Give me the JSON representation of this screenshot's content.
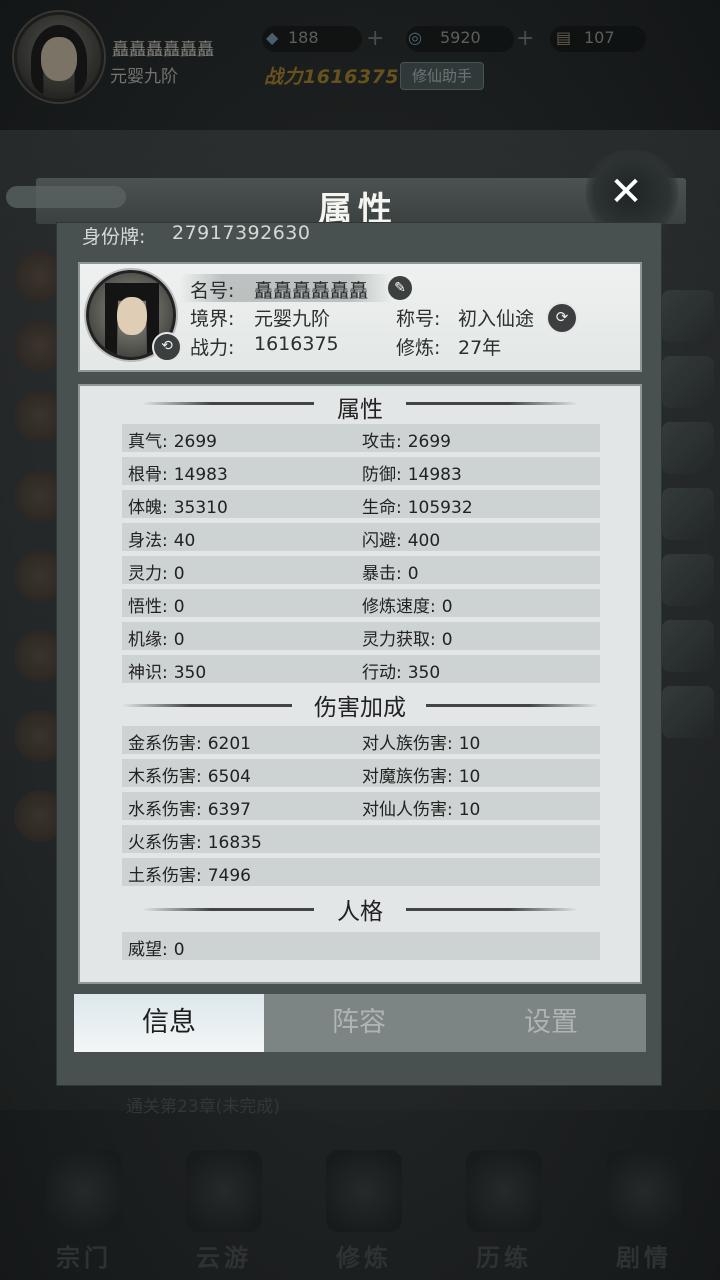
{
  "header": {
    "player_name": "矗矗矗矗矗矗",
    "realm": "元婴九阶",
    "resources": [
      {
        "icon": "crystal-icon",
        "value": "188"
      },
      {
        "icon": "spirit-orb-icon",
        "value": "5920"
      },
      {
        "icon": "scroll-icon",
        "value": "107"
      }
    ],
    "power_label": "战力",
    "power_value": "1616375",
    "helper_button": "修仙助手"
  },
  "background": {
    "chapter_title": "第二十三章",
    "chapter_progress": "通关第23章(未完成)"
  },
  "bottom_nav": [
    {
      "label": "宗门",
      "icon": "sect-icon"
    },
    {
      "label": "云游",
      "icon": "travel-icon"
    },
    {
      "label": "修炼",
      "icon": "cultivate-icon"
    },
    {
      "label": "历练",
      "icon": "trial-icon"
    },
    {
      "label": "剧情",
      "icon": "story-icon"
    }
  ],
  "modal": {
    "title": "属性",
    "close_icon": "close-icon",
    "id_label": "身份牌:",
    "id_value": "27917392630",
    "profile": {
      "name_label": "名号:",
      "name_value": "矗矗矗矗矗矗",
      "realm_label": "境界:",
      "realm_value": "元婴九阶",
      "title_label": "称号:",
      "title_value": "初入仙途",
      "power_label": "战力:",
      "power_value": "1616375",
      "cultivation_label": "修炼:",
      "cultivation_value": "27年"
    },
    "sections": {
      "attributes_title": "属性",
      "attributes": [
        [
          {
            "k": "真气:",
            "v": "2699"
          },
          {
            "k": "攻击:",
            "v": "2699"
          }
        ],
        [
          {
            "k": "根骨:",
            "v": "14983"
          },
          {
            "k": "防御:",
            "v": "14983"
          }
        ],
        [
          {
            "k": "体魄:",
            "v": "35310"
          },
          {
            "k": "生命:",
            "v": "105932"
          }
        ],
        [
          {
            "k": "身法:",
            "v": "40"
          },
          {
            "k": "闪避:",
            "v": "400"
          }
        ],
        [
          {
            "k": "灵力:",
            "v": "0"
          },
          {
            "k": "暴击:",
            "v": "0"
          }
        ],
        [
          {
            "k": "悟性:",
            "v": "0"
          },
          {
            "k": "修炼速度:",
            "v": "0"
          }
        ],
        [
          {
            "k": "机缘:",
            "v": "0"
          },
          {
            "k": "灵力获取:",
            "v": "0"
          }
        ],
        [
          {
            "k": "神识:",
            "v": "350"
          },
          {
            "k": "行动:",
            "v": "350"
          }
        ]
      ],
      "damage_title": "伤害加成",
      "damage": [
        [
          {
            "k": "金系伤害:",
            "v": "6201"
          },
          {
            "k": "对人族伤害:",
            "v": "10"
          }
        ],
        [
          {
            "k": "木系伤害:",
            "v": "6504"
          },
          {
            "k": "对魔族伤害:",
            "v": "10"
          }
        ],
        [
          {
            "k": "水系伤害:",
            "v": "6397"
          },
          {
            "k": "对仙人伤害:",
            "v": "10"
          }
        ],
        [
          {
            "k": "火系伤害:",
            "v": "16835"
          }
        ],
        [
          {
            "k": "土系伤害:",
            "v": "7496"
          }
        ]
      ],
      "personality_title": "人格",
      "personality": [
        [
          {
            "k": "威望:",
            "v": "0"
          }
        ]
      ]
    },
    "tabs": [
      {
        "label": "信息",
        "active": true
      },
      {
        "label": "阵容",
        "active": false
      },
      {
        "label": "设置",
        "active": false
      }
    ]
  }
}
